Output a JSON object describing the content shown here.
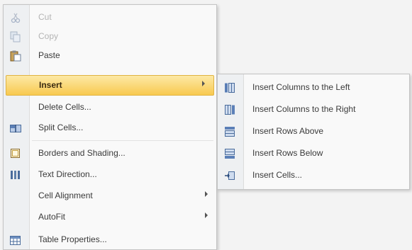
{
  "main_menu": {
    "items": [
      {
        "label": "Cut",
        "icon": "cut-icon",
        "disabled": true
      },
      {
        "label": "Copy",
        "icon": "copy-icon",
        "disabled": true
      },
      {
        "label": "Paste",
        "icon": "paste-icon"
      },
      {
        "label": "Insert",
        "icon": "",
        "highlighted": true,
        "submenu": true
      },
      {
        "label": "Delete Cells...",
        "icon": ""
      },
      {
        "label": "Split Cells...",
        "icon": "split-cells-icon"
      },
      {
        "label": "Borders and Shading...",
        "icon": "borders-icon"
      },
      {
        "label": "Text Direction...",
        "icon": "text-direction-icon"
      },
      {
        "label": "Cell Alignment",
        "icon": "",
        "submenu": true
      },
      {
        "label": "AutoFit",
        "icon": "",
        "submenu": true
      },
      {
        "label": "Table Properties...",
        "icon": "table-properties-icon"
      }
    ]
  },
  "insert_submenu": {
    "items": [
      {
        "label": "Insert Columns to the Left",
        "icon": "insert-columns-left-icon"
      },
      {
        "label": "Insert Columns to the Right",
        "icon": "insert-columns-right-icon"
      },
      {
        "label": "Insert Rows Above",
        "icon": "insert-rows-above-icon"
      },
      {
        "label": "Insert Rows Below",
        "icon": "insert-rows-below-icon"
      },
      {
        "label": "Insert Cells...",
        "icon": "insert-cells-icon"
      }
    ]
  },
  "colors": {
    "highlight_top": "#fde9a6",
    "highlight_bottom": "#f8c94f",
    "gutter": "#eef0f2",
    "disabled_text": "#b4b4b4"
  }
}
